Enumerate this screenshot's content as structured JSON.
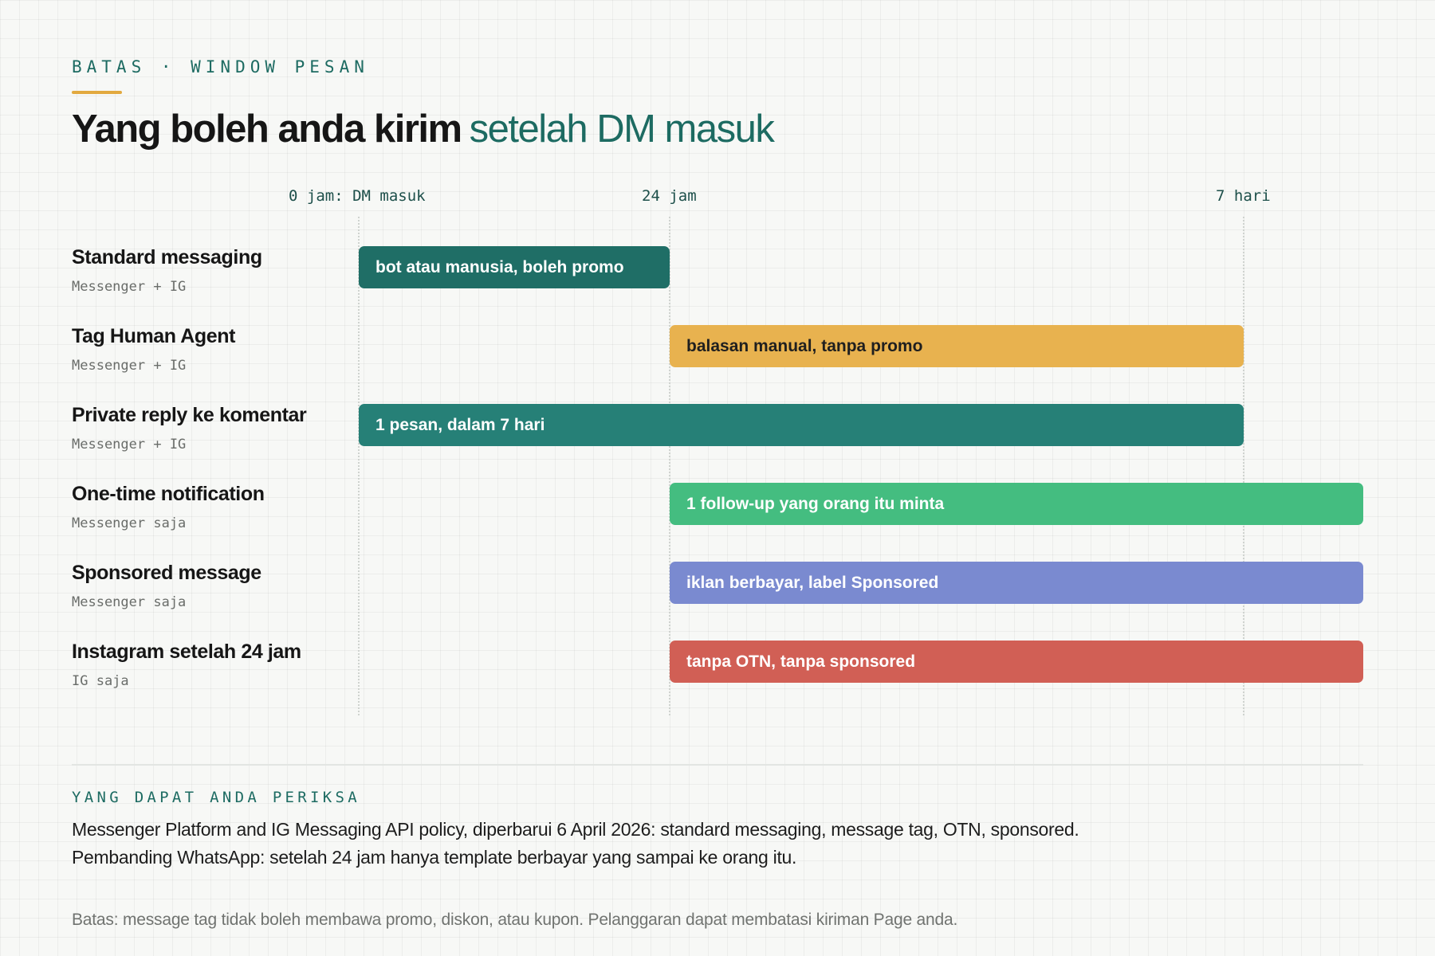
{
  "header": {
    "eyebrow": "BATAS · WINDOW PESAN",
    "title_bold": "Yang boleh anda kirim",
    "title_accent": "setelah DM masuk"
  },
  "timeline": {
    "markers": [
      "0 jam: DM masuk",
      "24 jam",
      "7 hari"
    ],
    "rows": [
      {
        "name": "Standard messaging",
        "channel": "Messenger + IG",
        "bar_label": "bot atau manusia, boleh promo",
        "start": "0 jam",
        "end": "24 jam",
        "color": "#1f6e66"
      },
      {
        "name": "Tag Human Agent",
        "channel": "Messenger + IG",
        "bar_label": "balasan manual, tanpa promo",
        "start": "24 jam",
        "end": "7 hari",
        "color": "#e8b24f"
      },
      {
        "name": "Private reply ke komentar",
        "channel": "Messenger + IG",
        "bar_label": "1 pesan, dalam 7 hari",
        "start": "0 jam",
        "end": "7 hari",
        "color": "#268077"
      },
      {
        "name": "One-time notification",
        "channel": "Messenger saja",
        "bar_label": "1 follow-up yang orang itu minta",
        "start": "24 jam",
        "end": "beyond 7 hari",
        "color": "#44bd80"
      },
      {
        "name": "Sponsored message",
        "channel": "Messenger saja",
        "bar_label": "iklan berbayar, label Sponsored",
        "start": "24 jam",
        "end": "beyond 7 hari",
        "color": "#7a8ad0"
      },
      {
        "name": "Instagram setelah 24 jam",
        "channel": "IG saja",
        "bar_label": "tanpa OTN, tanpa sponsored",
        "start": "24 jam",
        "end": "beyond 7 hari",
        "color": "#d15f55"
      }
    ]
  },
  "verify": {
    "label": "YANG DAPAT ANDA PERIKSA",
    "line1": "Messenger Platform and IG Messaging API policy, diperbarui 6 April 2026: standard messaging, message tag, OTN, sponsored.",
    "line2": "Pembanding WhatsApp: setelah 24 jam hanya template berbayar yang sampai ke orang itu."
  },
  "footnote": "Batas: message tag tidak boleh membawa promo, diskon, atau kupon. Pelanggaran dapat membatasi kiriman Page anda."
}
